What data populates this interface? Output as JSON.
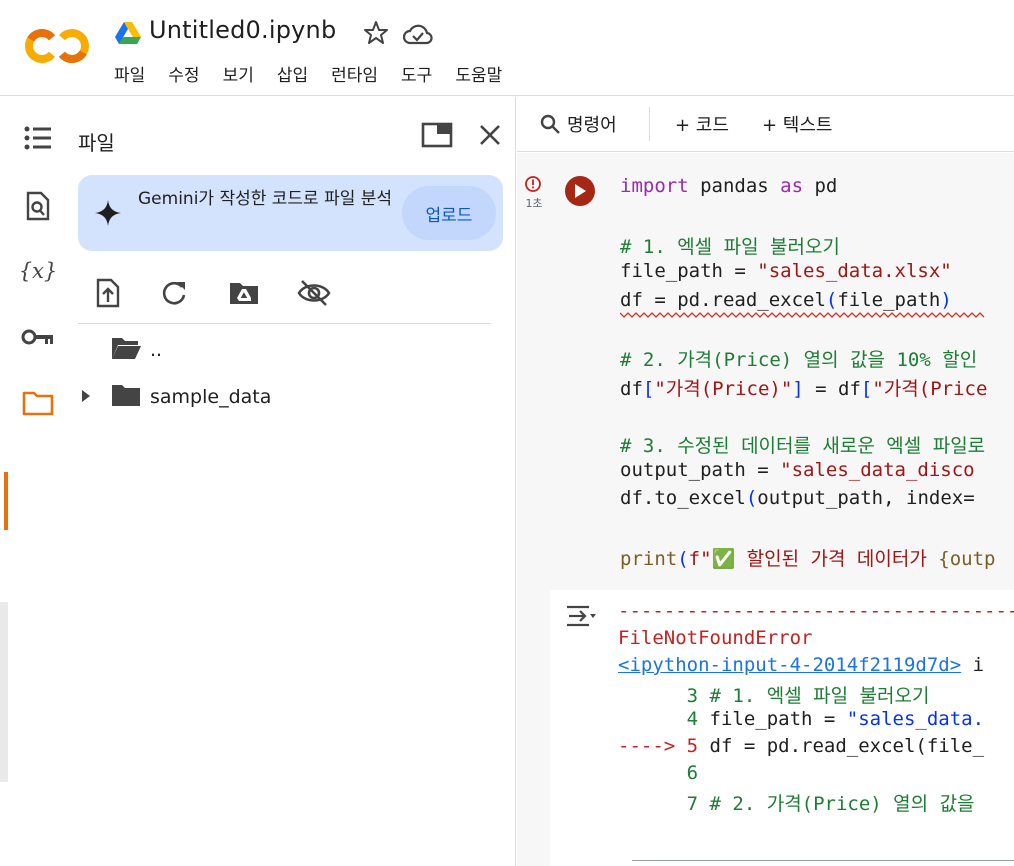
{
  "header": {
    "logo_text": "CO",
    "title": "Untitled0.ipynb",
    "menu": [
      "파일",
      "수정",
      "보기",
      "삽입",
      "런타임",
      "도구",
      "도움말"
    ]
  },
  "colors": {
    "accent_orange": "#e8710a",
    "logo_orange": "#f9ab00",
    "run_error": "#a52714",
    "gemini_card": "#d3e3fd",
    "link_blue": "#0b57d0"
  },
  "rail": {
    "icons": [
      "table-of-contents-icon",
      "find-icon",
      "variables-icon",
      "secrets-key-icon",
      "files-folder-icon"
    ],
    "variables_glyph": "{x}",
    "active": "files-folder-icon"
  },
  "panel": {
    "title": "파일",
    "gemini": {
      "text": "Gemini가 작성한 코드로 파일 분석",
      "button": "업로드"
    },
    "tools": [
      "upload-file-icon",
      "refresh-icon",
      "mount-drive-icon",
      "hide-files-icon"
    ],
    "items": [
      {
        "name": "..",
        "expandable": false
      },
      {
        "name": "sample_data",
        "expandable": true
      }
    ]
  },
  "toolbar": {
    "commands": "명령어",
    "add_code": "+ 코드",
    "add_text": "+ 텍스트"
  },
  "cell": {
    "exec_time": "1초",
    "status": "error",
    "code": [
      [
        [
          "kw",
          "import"
        ],
        [
          "bk",
          " pandas "
        ],
        [
          "kw",
          "as"
        ],
        [
          "bk",
          " pd"
        ]
      ],
      [],
      [
        [
          "cm",
          "# 1. 엑셀 파일 불러오기"
        ]
      ],
      [
        [
          "bk",
          "file_path = "
        ],
        [
          "st",
          "\"sales_data.xlsx\""
        ]
      ],
      [
        [
          "bk",
          "df = pd.read_excel"
        ],
        [
          "br",
          "("
        ],
        [
          "bk",
          "file_path"
        ],
        [
          "br",
          ")"
        ]
      ],
      [],
      [
        [
          "cm",
          "# 2. 가격(Price) 열의 값을 10% 할인"
        ]
      ],
      [
        [
          "bk",
          "df"
        ],
        [
          "br",
          "["
        ],
        [
          "st",
          "\"가격(Price)\""
        ],
        [
          "br",
          "]"
        ],
        [
          "bk",
          " = df"
        ],
        [
          "br",
          "["
        ],
        [
          "st",
          "\"가격(Price"
        ]
      ],
      [],
      [
        [
          "cm",
          "# 3. 수정된 데이터를 새로운 엑셀 파일로"
        ]
      ],
      [
        [
          "bk",
          "output_path = "
        ],
        [
          "st",
          "\"sales_data_disco"
        ]
      ],
      [
        [
          "bk",
          "df.to_excel"
        ],
        [
          "br",
          "("
        ],
        [
          "bk",
          "output_path, index="
        ]
      ],
      [],
      [
        [
          "fn",
          "print"
        ],
        [
          "br",
          "("
        ],
        [
          "st",
          "f\"✅ 할인된 가격 데이터가 "
        ],
        [
          "fn",
          "{outp"
        ]
      ]
    ]
  },
  "output": {
    "lines": [
      [
        [
          "err",
          "-------------------------------------"
        ]
      ],
      [
        [
          "err",
          "FileNotFoundError"
        ]
      ],
      [
        [
          "link",
          "<ipython-input-4-2014f2119d7d>"
        ],
        [
          "blk",
          " i"
        ]
      ],
      [
        [
          "num",
          "      3 "
        ],
        [
          "green",
          "# 1. 엑셀 파일 불러오기"
        ]
      ],
      [
        [
          "num",
          "      4 "
        ],
        [
          "blk",
          "file_path = "
        ],
        [
          "blue",
          "\"sales_data."
        ]
      ],
      [
        [
          "err",
          "----> 5 "
        ],
        [
          "blk",
          "df = pd.read_excel(file_"
        ]
      ],
      [
        [
          "num",
          "      6"
        ]
      ],
      [
        [
          "num",
          "      7 "
        ],
        [
          "green",
          "# 2. 가격(Price) 열의 값을"
        ]
      ]
    ]
  }
}
